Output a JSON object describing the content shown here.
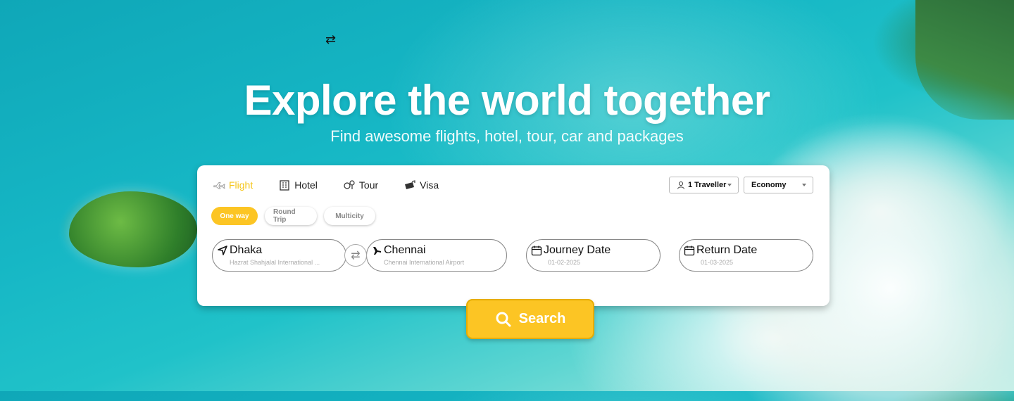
{
  "hero": {
    "swap_glyph": "⇄",
    "title": "Explore the world together",
    "subtitle": "Find awesome flights, hotel, tour, car and packages"
  },
  "tabs": [
    {
      "label": "Flight",
      "icon": "plane-icon",
      "active": true
    },
    {
      "label": "Hotel",
      "icon": "building-icon",
      "active": false
    },
    {
      "label": "Tour",
      "icon": "tour-icon",
      "active": false
    },
    {
      "label": "Visa",
      "icon": "passport-icon",
      "active": false
    }
  ],
  "selectors": {
    "travellers": "1 Traveller",
    "cabin_class": "Economy"
  },
  "trip_types": [
    "One way",
    "Round Trip",
    "Multicity"
  ],
  "search_fields": {
    "from": {
      "city": "Dhaka",
      "airport": "Hazrat Shahjalal International ..."
    },
    "to": {
      "city": "Chennai",
      "airport": "Chennai International Airport"
    },
    "journey": {
      "label": "Journey Date",
      "date": "01-02-2025"
    },
    "return": {
      "label": "Return Date",
      "date": "01-03-2025"
    },
    "swap_glyph": "⇄"
  },
  "search_button": "Search",
  "colors": {
    "accent": "#fcc524",
    "active_tab": "#f5c518"
  }
}
